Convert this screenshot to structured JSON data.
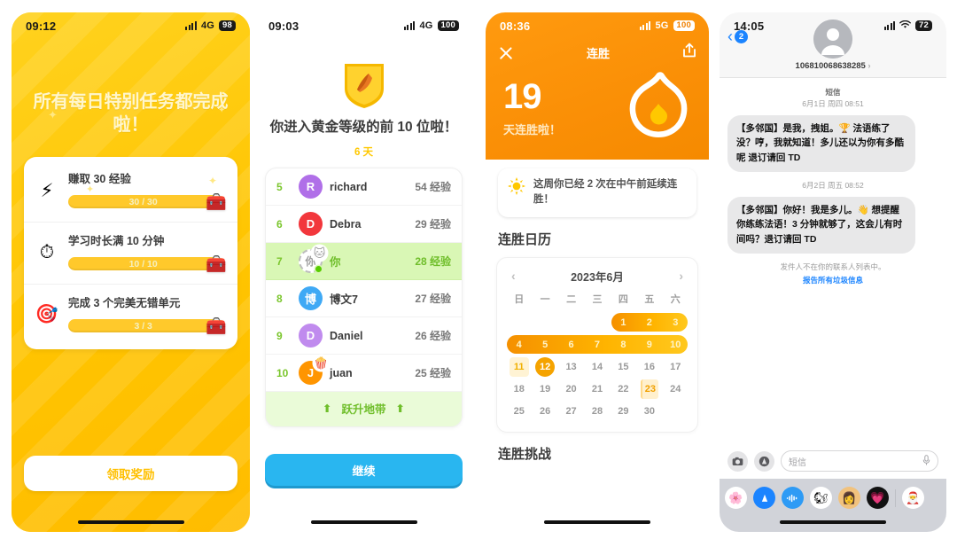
{
  "panels": {
    "daily_quests": {
      "status": {
        "time": "09:12",
        "network": "4G",
        "battery": "98"
      },
      "title": "所有每日特别任务都完成啦！",
      "tasks": [
        {
          "icon": "lightning-icon",
          "glyph": "⚡",
          "label": "赚取 30 经验",
          "progress": "30 / 30",
          "percent": 100,
          "chest": "🧰"
        },
        {
          "icon": "stopwatch-icon",
          "glyph": "⏱",
          "label": "学习时长满 10 分钟",
          "progress": "10 / 10",
          "percent": 100,
          "chest": "🧰"
        },
        {
          "icon": "target-icon",
          "glyph": "🎯",
          "label": "完成 3 个完美无错单元",
          "progress": "3 / 3",
          "percent": 100,
          "chest": "🧰"
        }
      ],
      "claim_label": "领取奖励"
    },
    "leaderboard": {
      "status": {
        "time": "09:03",
        "network": "4G",
        "battery": "100"
      },
      "badge": "gold-shield-icon",
      "headline": "你进入黄金等级的前 10 位啦！",
      "days_left": "6 天",
      "rows": [
        {
          "rank": "5",
          "avatar_letter": "R",
          "avatar_color": "#B06FE8",
          "name": "richard",
          "xp": "54 经验",
          "me": false,
          "emoji": ""
        },
        {
          "rank": "6",
          "avatar_letter": "D",
          "avatar_color": "#F2373C",
          "name": "Debra",
          "xp": "29 经验",
          "me": false,
          "emoji": ""
        },
        {
          "rank": "7",
          "avatar_letter": "你",
          "avatar_color": "",
          "name": "你",
          "xp": "28 经验",
          "me": true,
          "emoji": "🐱"
        },
        {
          "rank": "8",
          "avatar_letter": "博",
          "avatar_color": "#3FA9F5",
          "name": "博文7",
          "xp": "27 经验",
          "me": false,
          "emoji": ""
        },
        {
          "rank": "9",
          "avatar_letter": "D",
          "avatar_color": "#C08BEE",
          "name": "Daniel",
          "xp": "26 经验",
          "me": false,
          "emoji": ""
        },
        {
          "rank": "10",
          "avatar_letter": "J",
          "avatar_color": "#FF9500",
          "name": "juan",
          "xp": "25 经验",
          "me": false,
          "emoji": "🍿"
        }
      ],
      "promotion_zone": "跃升地带",
      "continue_label": "继续"
    },
    "streak": {
      "status": {
        "time": "08:36",
        "network": "5G",
        "battery": "100"
      },
      "nav_title": "连胜",
      "close_icon": "close-icon",
      "share_icon": "share-icon",
      "count": "19",
      "count_sub": "天连胜啦！",
      "flame_icon": "flame-icon",
      "note_icon": "sun-icon",
      "note": "这周你已经 2 次在中午前延续连胜！",
      "calendar_heading": "连胜日历",
      "calendar": {
        "month_label": "2023年6月",
        "prev_icon": "chevron-left-icon",
        "next_icon": "chevron-right-icon",
        "dow": [
          "日",
          "一",
          "二",
          "三",
          "四",
          "五",
          "六"
        ],
        "weeks": [
          [
            {
              "d": "",
              "t": "blank"
            },
            {
              "d": "",
              "t": "blank"
            },
            {
              "d": "",
              "t": "blank"
            },
            {
              "d": "",
              "t": "blank"
            },
            {
              "d": "1",
              "t": "streak"
            },
            {
              "d": "2",
              "t": "streak"
            },
            {
              "d": "3",
              "t": "streak"
            }
          ],
          [
            {
              "d": "4",
              "t": "streak"
            },
            {
              "d": "5",
              "t": "streak"
            },
            {
              "d": "6",
              "t": "streak"
            },
            {
              "d": "7",
              "t": "streak"
            },
            {
              "d": "8",
              "t": "streak"
            },
            {
              "d": "9",
              "t": "streak"
            },
            {
              "d": "10",
              "t": "streak"
            }
          ],
          [
            {
              "d": "11",
              "t": "soft"
            },
            {
              "d": "12",
              "t": "today"
            },
            {
              "d": "13",
              "t": "plain"
            },
            {
              "d": "14",
              "t": "plain"
            },
            {
              "d": "15",
              "t": "plain"
            },
            {
              "d": "16",
              "t": "plain"
            },
            {
              "d": "17",
              "t": "plain"
            }
          ],
          [
            {
              "d": "18",
              "t": "plain"
            },
            {
              "d": "19",
              "t": "plain"
            },
            {
              "d": "20",
              "t": "plain"
            },
            {
              "d": "21",
              "t": "plain"
            },
            {
              "d": "22",
              "t": "plain"
            },
            {
              "d": "23",
              "t": "marked"
            },
            {
              "d": "24",
              "t": "plain"
            }
          ],
          [
            {
              "d": "25",
              "t": "plain"
            },
            {
              "d": "26",
              "t": "plain"
            },
            {
              "d": "27",
              "t": "plain"
            },
            {
              "d": "28",
              "t": "plain"
            },
            {
              "d": "29",
              "t": "plain"
            },
            {
              "d": "30",
              "t": "plain"
            },
            {
              "d": "",
              "t": "blank"
            }
          ]
        ]
      },
      "challenge_heading": "连胜挑战"
    },
    "messages": {
      "status": {
        "time": "14:05",
        "network": "wifi",
        "battery": "72"
      },
      "back_badge": "2",
      "contact_number": "106810068638285",
      "service_label": "短信",
      "thread": [
        {
          "timestamp": "6月1日 周四 08:51",
          "text": "【多邻国】是我，拽姐。🏆 法语练了没？哼，我就知道！多儿还以为你有多酷呢 退订请回 TD"
        },
        {
          "timestamp": "6月2日 周五 08:52",
          "text": "【多邻国】你好！我是多儿。👋 想提醒你练练法语！3 分钟就够了，这会儿有时间吗？退订请回 TD"
        }
      ],
      "not_contact_note": "发件人不在你的联系人列表中。",
      "report_link": "报告所有垃圾信息",
      "input_placeholder": "短信",
      "camera_icon": "camera-icon",
      "appstore_icon": "app-store-icon",
      "mic_icon": "microphone-icon",
      "dock": [
        {
          "name": "photos-app-icon",
          "glyph": "🌸",
          "bg": "#FFFFFF"
        },
        {
          "name": "app-store-icon",
          "glyph": "A",
          "bg": "#1B84FF"
        },
        {
          "name": "audio-message-icon",
          "glyph": "🎚",
          "bg": "#2E9BF5"
        },
        {
          "name": "sticker-pack-icon",
          "glyph": "🐿",
          "bg": "#FFFFFF"
        },
        {
          "name": "memoji-icon",
          "glyph": "👩",
          "bg": "#F1C27D"
        },
        {
          "name": "digital-touch-icon",
          "glyph": "💗",
          "bg": "#111111"
        },
        {
          "name": "recent-sticker-icon",
          "glyph": "🎅",
          "bg": "#FFFFFF"
        }
      ]
    }
  },
  "colors": {
    "duo_yellow": "#FFC800",
    "duo_green": "#58CC02",
    "duo_blue": "#29B6F0",
    "streak_orange": "#FA8F06",
    "ios_blue": "#1B84FF"
  }
}
